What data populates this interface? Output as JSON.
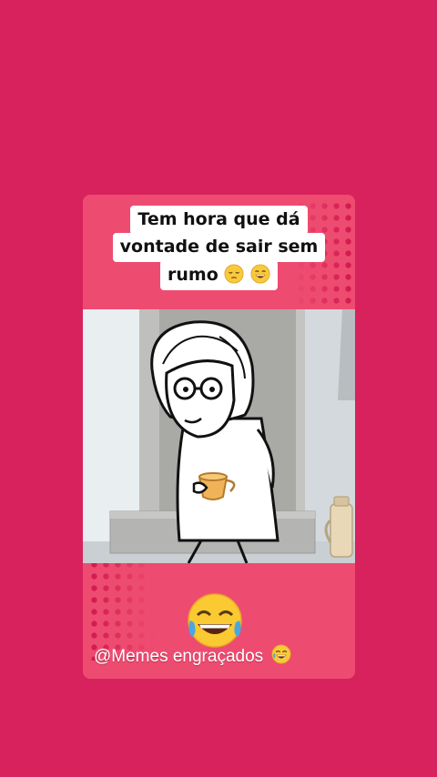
{
  "caption": {
    "line1": "Tem hora que dá",
    "line2": "vontade de sair sem",
    "line3": "rumo"
  },
  "caption_emojis": [
    "pensive-face",
    "grinning-face-with-smiling-eyes"
  ],
  "watermark": {
    "text": "@Memes engraçados",
    "emoji": "face-with-tears-of-joy"
  },
  "colors": {
    "background": "#d8225d",
    "card": "#ee4b70",
    "dots": "#d0184f"
  }
}
